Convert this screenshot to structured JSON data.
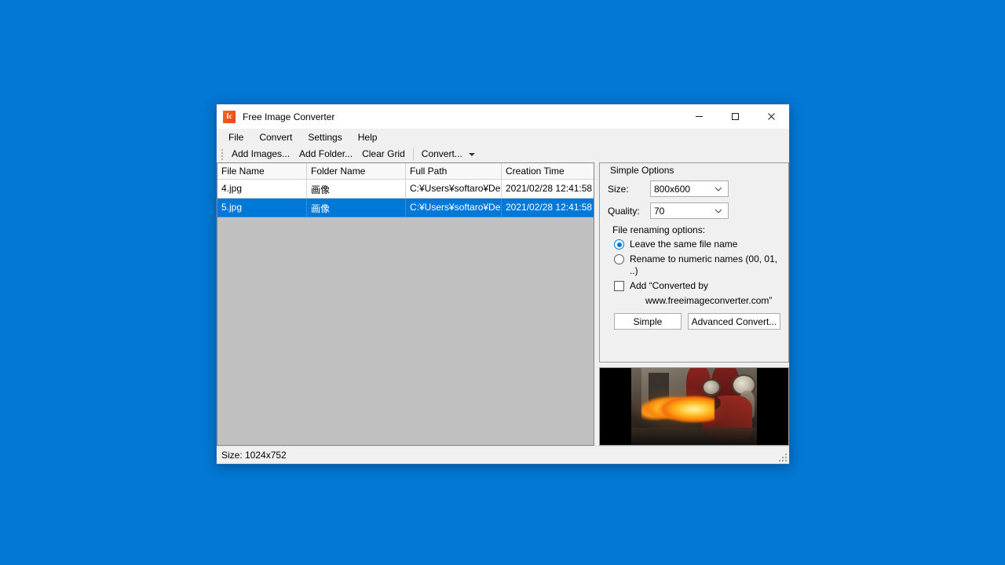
{
  "window": {
    "title": "Free Image Converter",
    "icon": "app-icon-ic",
    "minimize_label": "Minimize",
    "maximize_label": "Maximize",
    "close_label": "Close"
  },
  "menubar": {
    "items": [
      {
        "label": "File"
      },
      {
        "label": "Convert"
      },
      {
        "label": "Settings"
      },
      {
        "label": "Help"
      }
    ]
  },
  "toolbar": {
    "add_images": "Add Images...",
    "add_folder": "Add Folder...",
    "clear_grid": "Clear Grid",
    "convert": "Convert..."
  },
  "grid": {
    "columns": [
      "File Name",
      "Folder Name",
      "Full Path",
      "Creation Time"
    ],
    "rows": [
      {
        "file_name": "4.jpg",
        "folder_name": "画像",
        "full_path": "C:¥Users¥softaro¥De...",
        "creation_time": "2021/02/28 12:41:58",
        "selected": false
      },
      {
        "file_name": "5.jpg",
        "folder_name": "画像",
        "full_path": "C:¥Users¥softaro¥De...",
        "creation_time": "2021/02/28 12:41:58",
        "selected": true
      }
    ]
  },
  "options": {
    "panel_title": "Simple Options",
    "size_label": "Size:",
    "size_value": "800x600",
    "quality_label": "Quality:",
    "quality_value": "70",
    "renaming_label": "File renaming options:",
    "radio_same_name": "Leave the same file name",
    "radio_numeric": "Rename to numeric names (00, 01, ..)",
    "checkbox_add_converted": "Add “Converted by",
    "checkbox_add_converted_line2": "www.freeimageconverter.com”",
    "btn_simple": "Simple",
    "btn_advanced": "Advanced Convert..."
  },
  "preview": {
    "alt": "fire breather photo preview"
  },
  "statusbar": {
    "size_text": "Size: 1024x752"
  },
  "colors": {
    "desktop": "#0378d4",
    "selection": "#0078d7",
    "accent": "#0078d7",
    "window_border": "#2a6fb5",
    "grid_empty": "#c0c0c0"
  }
}
